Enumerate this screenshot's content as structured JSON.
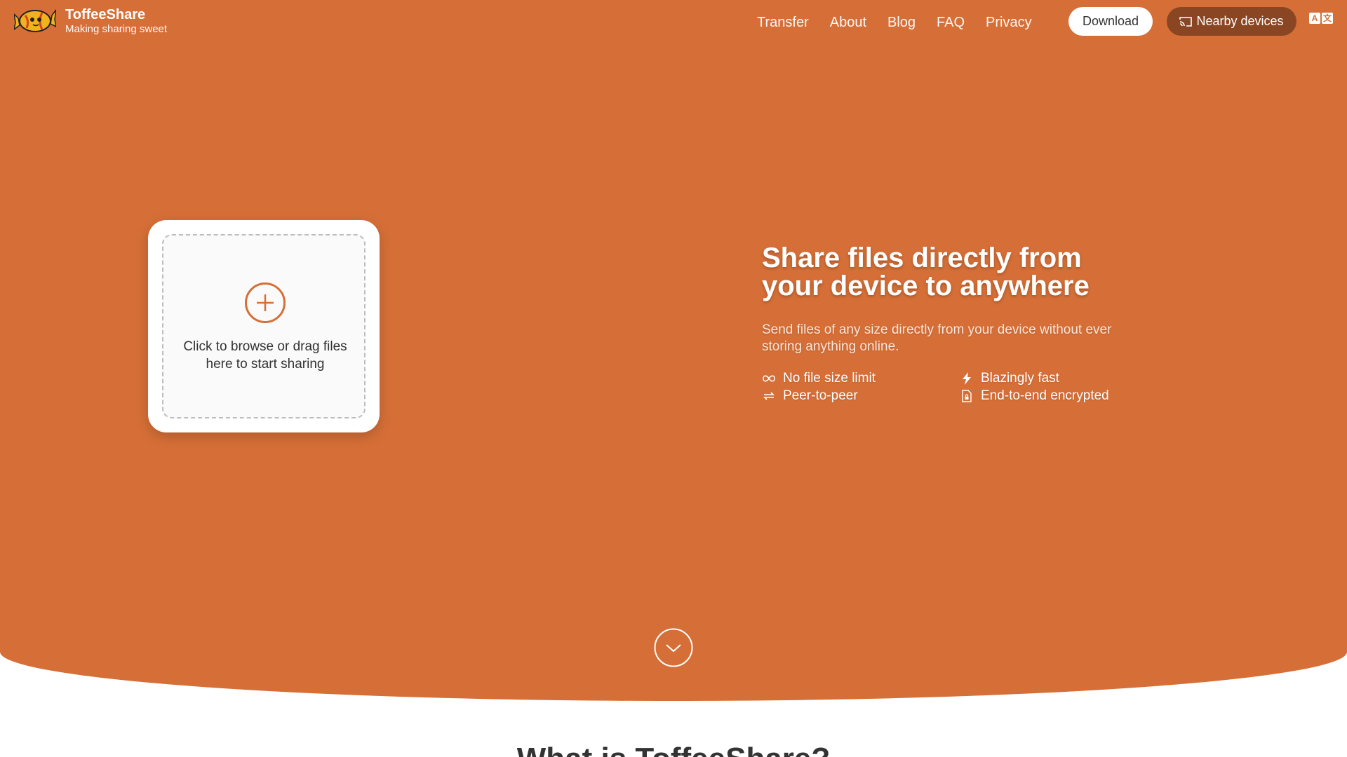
{
  "brand": {
    "name": "ToffeeShare",
    "tagline": "Making sharing sweet"
  },
  "nav": {
    "items": [
      "Transfer",
      "About",
      "Blog",
      "FAQ",
      "Privacy"
    ],
    "download_label": "Download",
    "nearby_label": "Nearby devices"
  },
  "upload": {
    "text": "Click to browse or drag files here to start sharing"
  },
  "hero": {
    "headline": "Share files directly from your device to anywhere",
    "subtext": "Send files of any size directly from your device without ever storing anything online.",
    "features": [
      {
        "label": "No file size limit",
        "icon": "infinity-icon"
      },
      {
        "label": "Blazingly fast",
        "icon": "bolt-icon"
      },
      {
        "label": "Peer-to-peer",
        "icon": "swap-icon"
      },
      {
        "label": "End-to-end encrypted",
        "icon": "lock-file-icon"
      }
    ]
  },
  "section": {
    "title": "What is ToffeeShare?"
  },
  "colors": {
    "accent": "#d66f37",
    "nearby_button": "#8a4623"
  }
}
